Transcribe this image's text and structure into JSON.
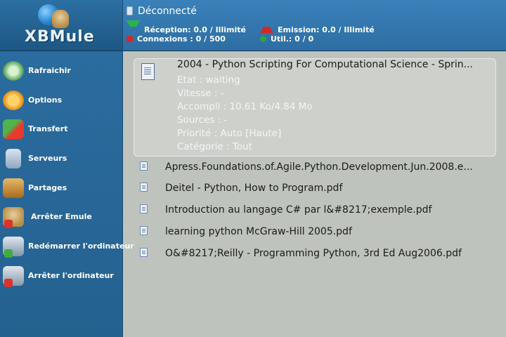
{
  "app": {
    "logo_text": "XBMule"
  },
  "status": {
    "title": "Déconnecté",
    "reception": "Réception: 0.0 / Illimité",
    "emission": "Emission: 0.0 / Illimité",
    "connexions": "Connexions : 0 / 500",
    "util": "Util.: 0 / 0"
  },
  "sidebar": {
    "items": [
      {
        "label": "Rafraichir",
        "icon": "refresh-icon"
      },
      {
        "label": "Options",
        "icon": "gear-icon"
      },
      {
        "label": "Transfert",
        "icon": "transfer-folder-icon"
      },
      {
        "label": "Serveurs",
        "icon": "servers-icon"
      },
      {
        "label": "Partages",
        "icon": "shares-box-icon"
      },
      {
        "label": "Arrêter Emule",
        "icon": "stop-emule-icon"
      },
      {
        "label": "Redémarrer l'ordinateur",
        "icon": "restart-computer-icon"
      },
      {
        "label": "Arrêter l'ordinateur",
        "icon": "shutdown-computer-icon"
      }
    ]
  },
  "downloads": {
    "selected": {
      "title": "2004 - Python Scripting For Computational Science - Sprin...",
      "etat": "Etat : waiting",
      "vitesse": "Vitesse : -",
      "accompli": "Accompli : 10.61 Ko/4.84 Mo",
      "sources": "Sources : -",
      "priorite": "Priorité : Auto [Haute]",
      "categorie": "Catégorie : Tout"
    },
    "files": [
      "Apress.Foundations.of.Agile.Python.Development.Jun.2008.e...",
      "Deitel - Python, How to Program.pdf",
      "Introduction au langage C# par l&#8217;exemple.pdf",
      "learning python McGraw-Hill 2005.pdf",
      "O&#8217;Reilly - Programming Python, 3rd Ed Aug2006.pdf"
    ]
  },
  "colors": {
    "sidebar_bg": "#2b6c9f",
    "header_bg": "#3a81ba",
    "content_bg": "#bfc3bd",
    "reception_arrow": "#2bb34a",
    "emission_arrow": "#d3282a"
  }
}
